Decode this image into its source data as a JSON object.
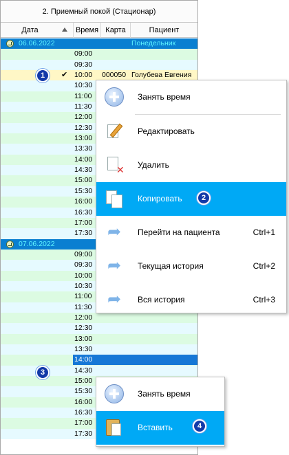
{
  "grid": {
    "title": "2. Приемный покой (Стационар)",
    "headers": {
      "date": "Дата",
      "time": "Время",
      "card": "Карта",
      "patient": "Пациент"
    },
    "day1": {
      "date": "06.06.2022",
      "weekday": "Понедельник"
    },
    "day1_times": [
      "09:00",
      "09:30",
      "10:00",
      "10:30",
      "11:00",
      "11:30",
      "12:00",
      "12:30",
      "13:00",
      "13:30",
      "14:00",
      "14:30",
      "15:00",
      "15:30",
      "16:00",
      "16:30",
      "17:00",
      "17:30"
    ],
    "selected_row": {
      "time": "10:00",
      "card": "000050",
      "patient": "Голубева Евгения",
      "check": "✔"
    },
    "day2": {
      "date": "07.06.2022"
    },
    "day2_times": [
      "09:00",
      "09:30",
      "10:00",
      "10:30",
      "11:00",
      "11:30",
      "12:00",
      "12:30",
      "13:00",
      "13:30",
      "14:00",
      "14:30",
      "15:00",
      "15:30",
      "16:00",
      "16:30",
      "17:00",
      "17:30"
    ]
  },
  "menu1": {
    "items": [
      {
        "label": "Занять время",
        "shortcut": "",
        "icon": "plus-circle-icon"
      },
      {
        "label": "Редактировать",
        "shortcut": "",
        "icon": "edit-icon"
      },
      {
        "label": "Удалить",
        "shortcut": "",
        "icon": "delete-icon"
      },
      {
        "label": "Копировать",
        "shortcut": "",
        "icon": "copy-icon"
      },
      {
        "label": "Перейти на пациента",
        "shortcut": "Ctrl+1",
        "icon": "arrow-icon"
      },
      {
        "label": "Текущая история",
        "shortcut": "Ctrl+2",
        "icon": "arrow-icon"
      },
      {
        "label": "Вся история",
        "shortcut": "Ctrl+3",
        "icon": "arrow-icon"
      }
    ]
  },
  "menu2": {
    "items": [
      {
        "label": "Занять время",
        "icon": "plus-circle-icon"
      },
      {
        "label": "Вставить",
        "icon": "paste-icon"
      }
    ]
  },
  "badges": [
    "1",
    "2",
    "3",
    "4"
  ],
  "colors": {
    "day_header": "#0a7fd1",
    "day_text": "#5ff4ff",
    "row_a": "#e6faff",
    "row_b": "#dcfbe2",
    "highlight": "#00a9f5",
    "badge": "#1239a8"
  }
}
